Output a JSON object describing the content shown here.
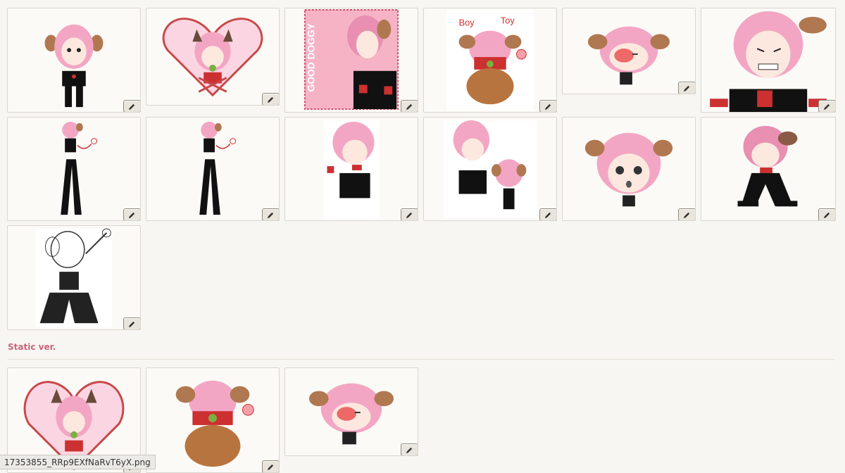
{
  "gallery": {
    "items": [
      {
        "name": "sticker-chibi-dog-ears"
      },
      {
        "name": "sticker-heart-frame"
      },
      {
        "name": "sticker-good-doggy"
      },
      {
        "name": "sticker-boy-toy-bear"
      },
      {
        "name": "sticker-blushing-head"
      },
      {
        "name": "sticker-nervous-face"
      },
      {
        "name": "sticker-standing-leash"
      },
      {
        "name": "sticker-standing-leash-2"
      },
      {
        "name": "sticker-collar-portrait"
      },
      {
        "name": "sticker-portrait-with-chibi"
      },
      {
        "name": "sticker-pouting-head"
      },
      {
        "name": "sticker-crouching-phone"
      },
      {
        "name": "sticker-lineart-sketch"
      }
    ],
    "edit_icon": "pencil-icon"
  },
  "static_section": {
    "label": "Static ver.",
    "items": [
      {
        "name": "static-heart-frame"
      },
      {
        "name": "static-boy-toy-bear"
      },
      {
        "name": "static-blushing-head"
      }
    ]
  },
  "status_bar": {
    "filename": "17353855_RRp9EXfNaRvT6yX.png"
  },
  "colors": {
    "accent_label": "#c8657a",
    "hair_pink": "#f3a6c4",
    "ear_brown": "#b07850"
  }
}
